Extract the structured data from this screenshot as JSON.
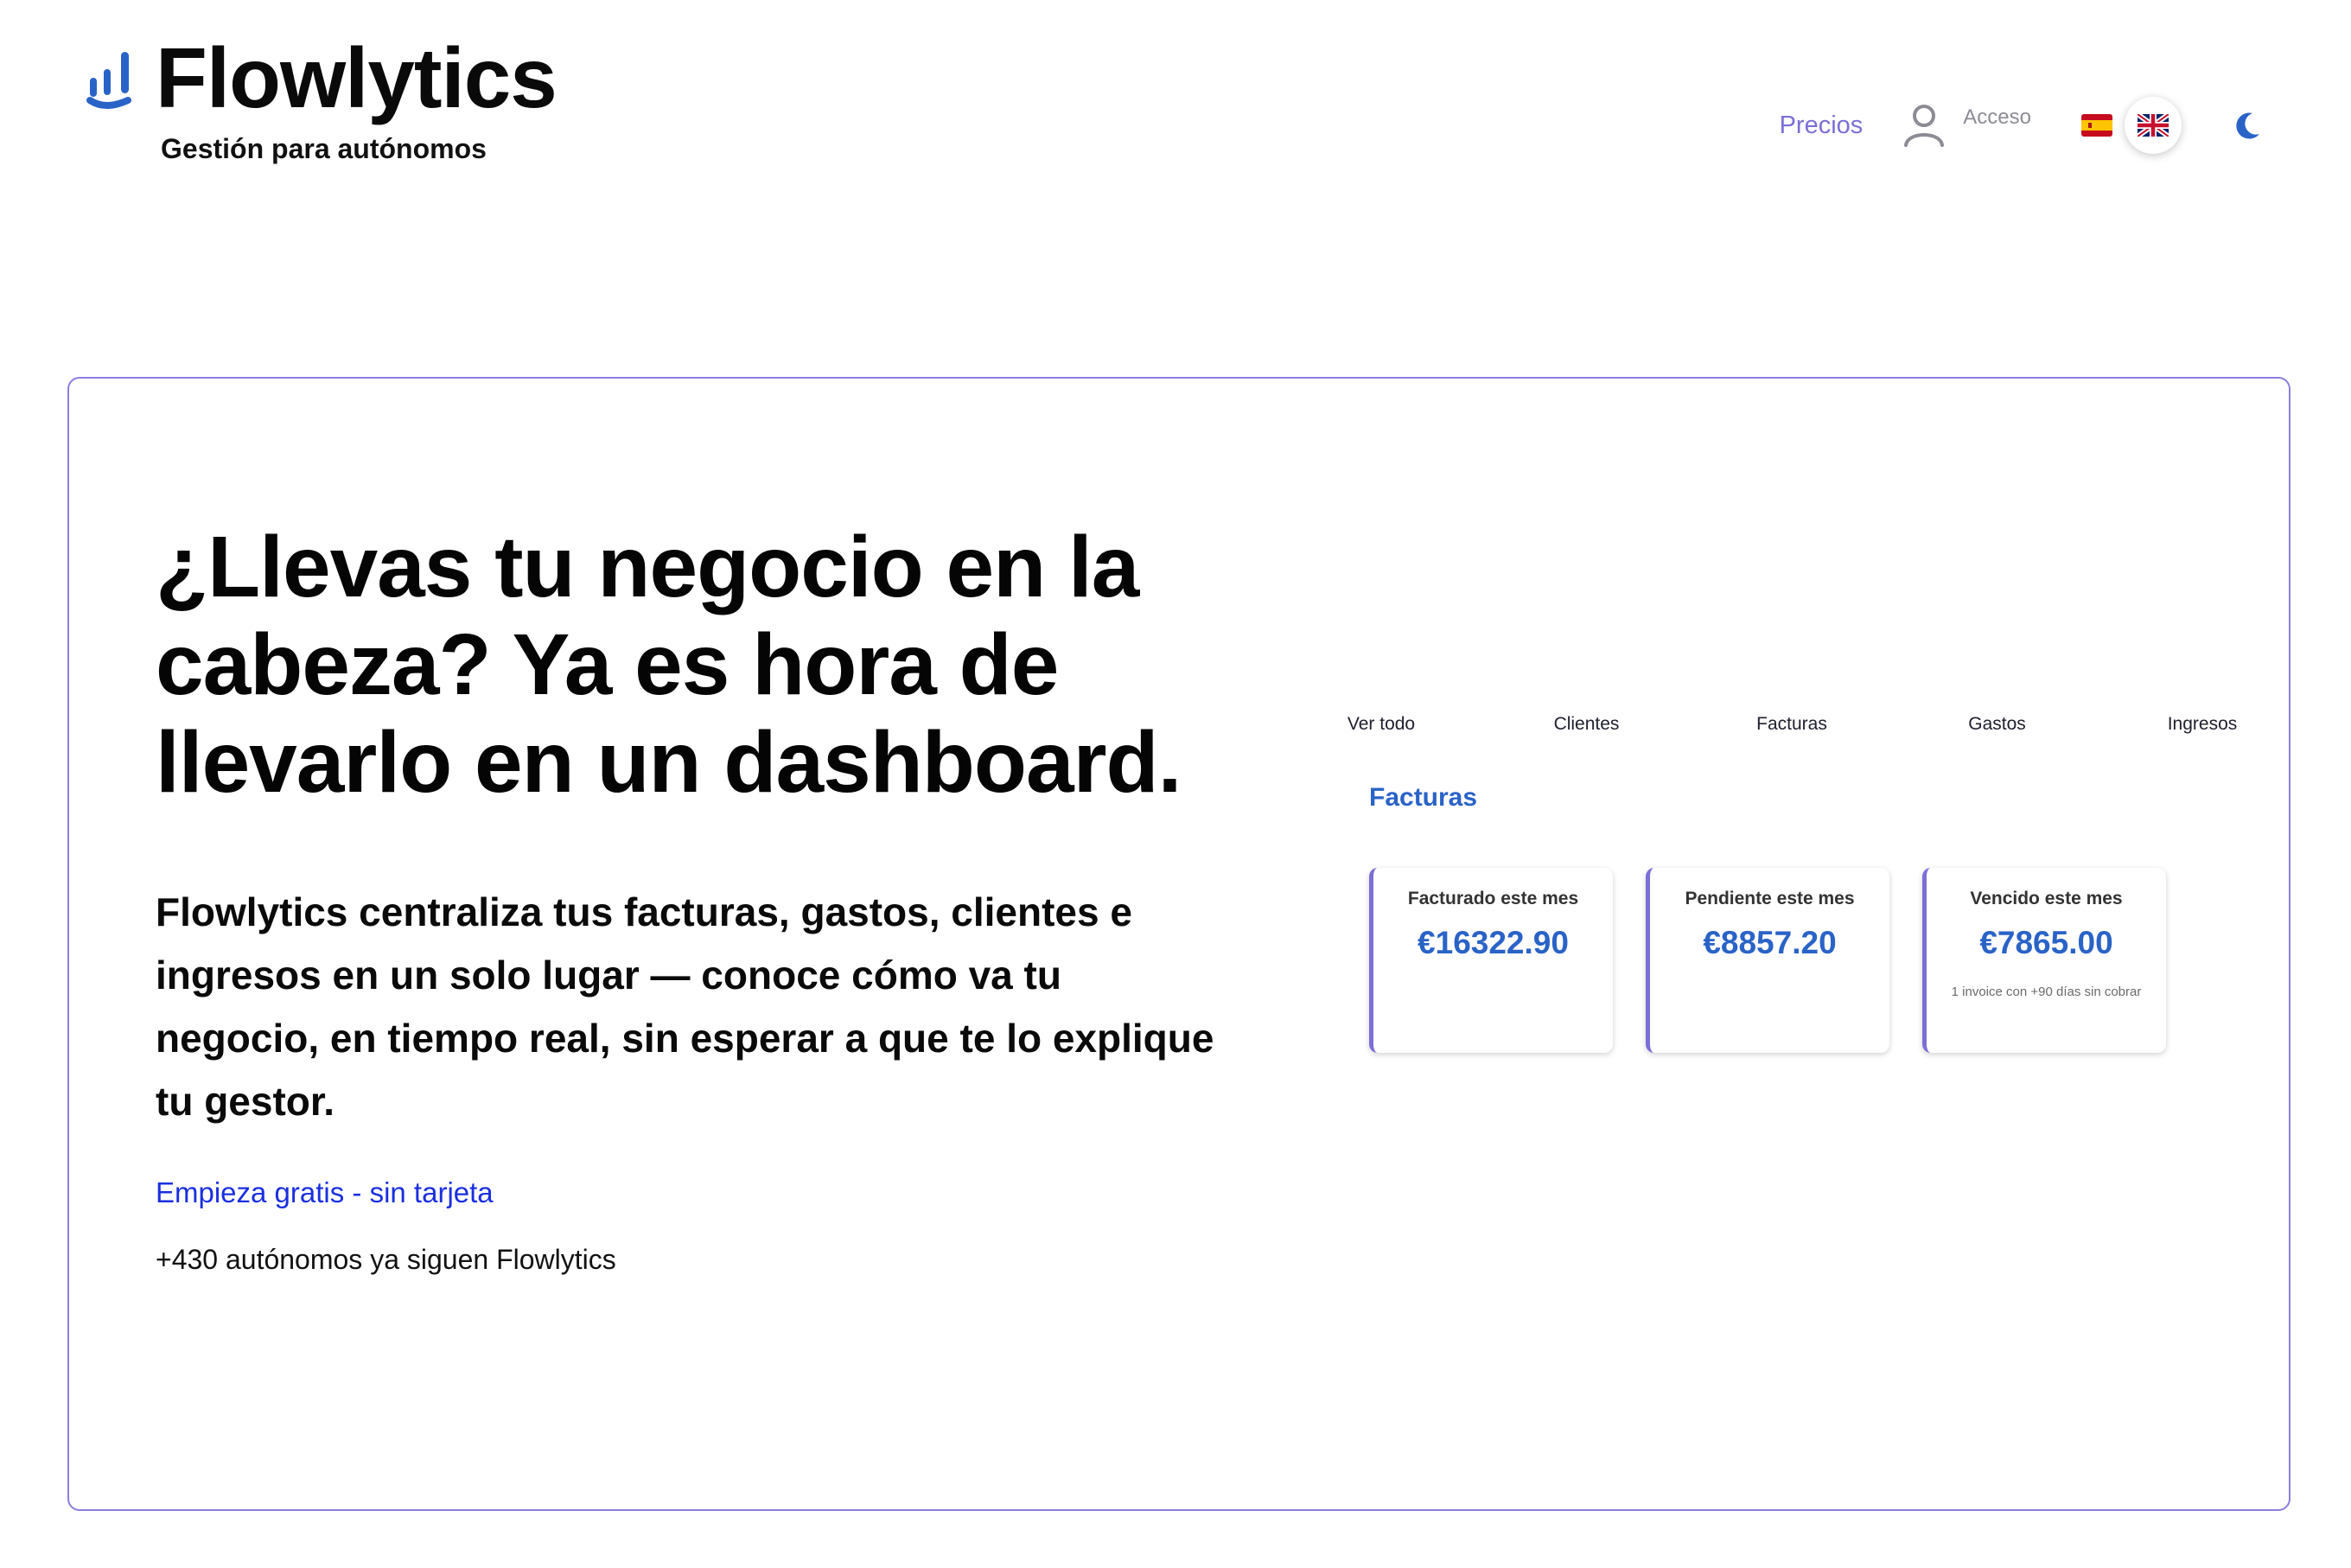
{
  "brand": {
    "name": "Flowlytics",
    "tagline": "Gestión para autónomos",
    "accent_color": "#2a63c7",
    "icon": "bar-chart-logo-icon"
  },
  "nav": {
    "pricing_label": "Precios",
    "login_label": "Acceso",
    "login_icon": "user-icon",
    "languages": [
      {
        "code": "es",
        "icon": "spain-flag-icon",
        "selected": false
      },
      {
        "code": "en",
        "icon": "uk-flag-icon",
        "selected": true
      }
    ],
    "theme_icon": "moon-icon",
    "link_color": "#7b6fd6"
  },
  "hero": {
    "headline": "¿Llevas tu negocio en la cabeza? Ya es hora de llevarlo en un dashboard.",
    "subhead": "Flowlytics centraliza tus facturas, gastos, clientes e ingresos en un solo lugar — conoce cómo va tu negocio, en tiempo real, sin esperar a que te lo explique tu gestor.",
    "cta_label": "Empieza gratis - sin tarjeta",
    "social_proof": "+430 autónomos ya siguen Flowlytics",
    "border_color": "#8b7fe0"
  },
  "dashboard": {
    "tabs": [
      "Ver todo",
      "Clientes",
      "Facturas",
      "Gastos",
      "Ingresos"
    ],
    "section_title": "Facturas",
    "cards": [
      {
        "label": "Facturado este mes",
        "value": "€16322.90",
        "note": ""
      },
      {
        "label": "Pendiente este mes",
        "value": "€8857.20",
        "note": ""
      },
      {
        "label": "Vencido este mes",
        "value": "€7865.00",
        "note": "1 invoice con +90 días sin cobrar"
      }
    ]
  }
}
